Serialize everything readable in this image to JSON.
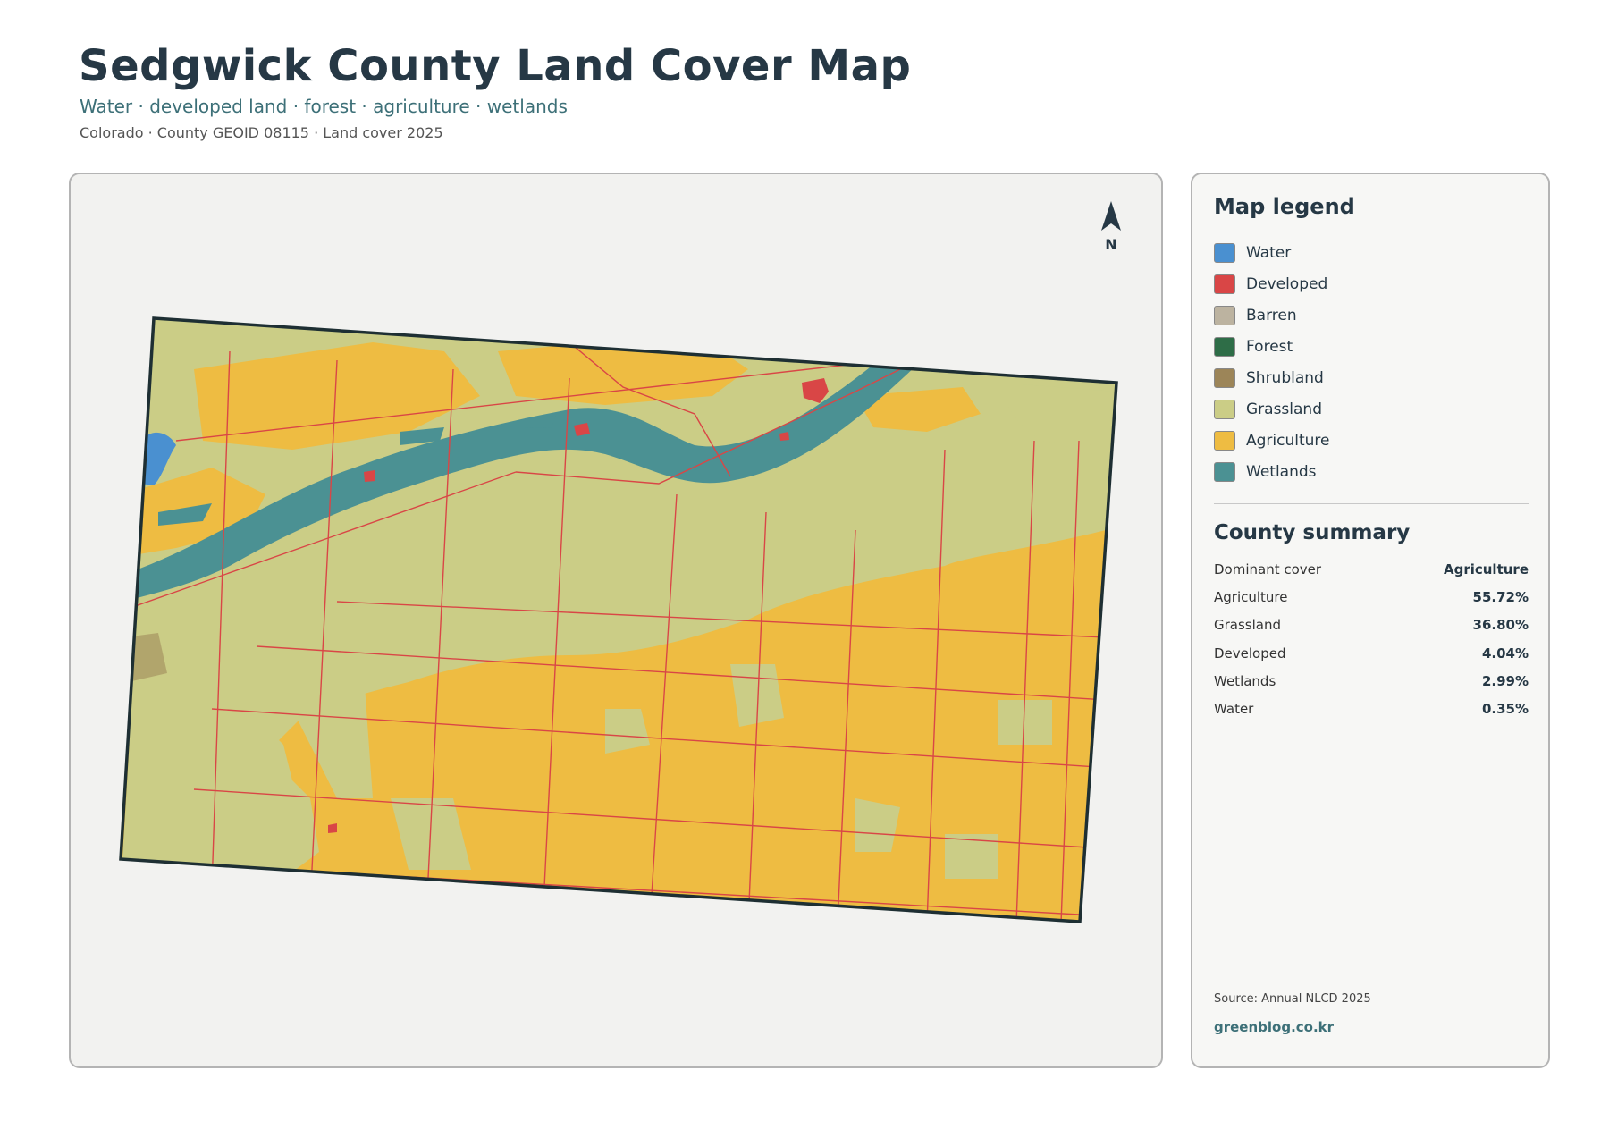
{
  "header": {
    "title": "Sedgwick County Land Cover Map",
    "subtitle": "Water · developed land · forest · agriculture · wetlands",
    "meta": "Colorado · County GEOID 08115 · Land cover 2025"
  },
  "map": {
    "north_label": "N",
    "colors": {
      "water": "#4a90d0",
      "developed": "#d94646",
      "barren": "#bcb3a0",
      "forest": "#2e6d47",
      "shrubland": "#9c8558",
      "grassland": "#cbcd86",
      "agriculture": "#eebc42",
      "wetlands": "#4b9193",
      "outline": "#1e2f33"
    }
  },
  "legend": {
    "title": "Map legend",
    "items": [
      {
        "label": "Water",
        "color": "#4a90d0"
      },
      {
        "label": "Developed",
        "color": "#d94646"
      },
      {
        "label": "Barren",
        "color": "#bcb3a0"
      },
      {
        "label": "Forest",
        "color": "#2e6d47"
      },
      {
        "label": "Shrubland",
        "color": "#9c8558"
      },
      {
        "label": "Grassland",
        "color": "#cbcd86"
      },
      {
        "label": "Agriculture",
        "color": "#eebc42"
      },
      {
        "label": "Wetlands",
        "color": "#4b9193"
      }
    ]
  },
  "summary": {
    "title": "County summary",
    "rows": [
      {
        "label": "Dominant cover",
        "value": "Agriculture"
      },
      {
        "label": "Agriculture",
        "value": "55.72%"
      },
      {
        "label": "Grassland",
        "value": "36.80%"
      },
      {
        "label": "Developed",
        "value": "4.04%"
      },
      {
        "label": "Wetlands",
        "value": "2.99%"
      },
      {
        "label": "Water",
        "value": "0.35%"
      }
    ]
  },
  "footer": {
    "source": "Source: Annual NLCD 2025",
    "site": "greenblog.co.kr"
  }
}
